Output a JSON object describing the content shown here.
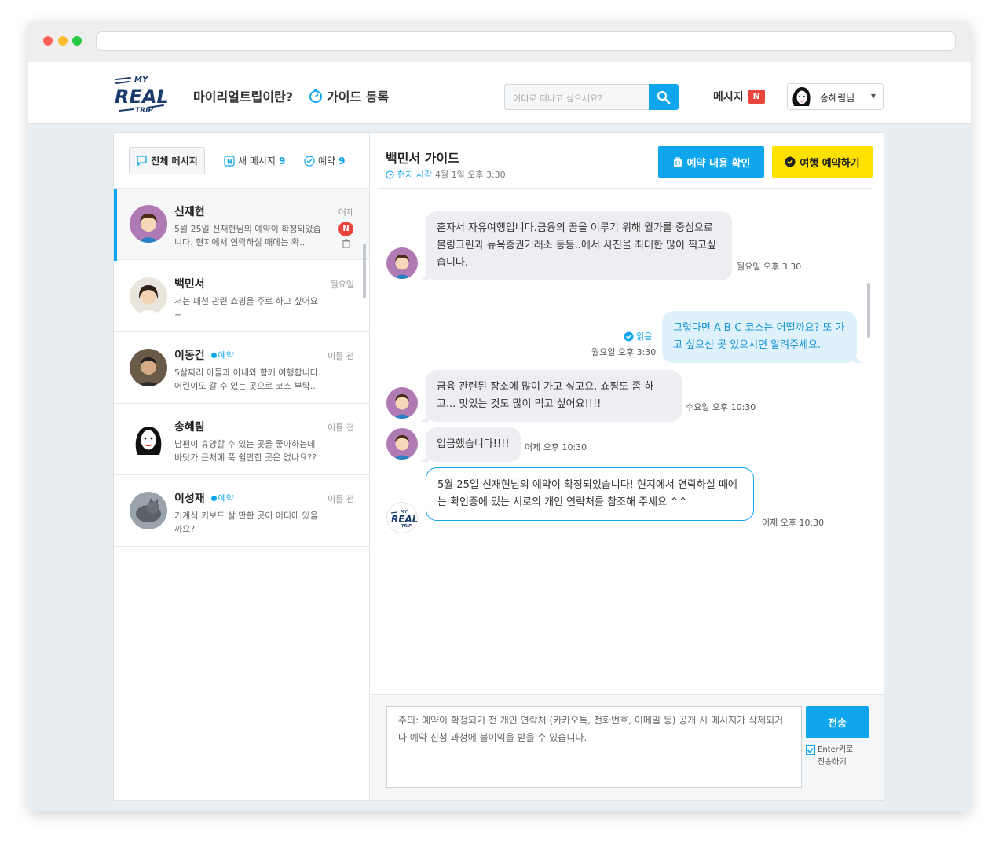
{
  "header": {
    "logo": {
      "line1": "MY",
      "line2": "REAL",
      "line3": "TRIP"
    },
    "nav_about": "마이리얼트립이란?",
    "nav_guide": "가이드 등록",
    "search_placeholder": "어디로 떠나고 싶으세요?",
    "messages_label": "메시지",
    "messages_badge": "N",
    "user_name": "송혜림님"
  },
  "tabs": {
    "all_label": "전체 메시지",
    "new_label": "새 메시지",
    "new_count": "9",
    "resv_label": "예약",
    "resv_count": "9"
  },
  "conversations": [
    {
      "name": "신재현",
      "preview": "5월 25일 신재현님의 예약이 확정되었습니다. 현지에서 연락하실 때에는 확..",
      "time": "어제",
      "badge": "N",
      "tag": ""
    },
    {
      "name": "백민서",
      "preview": "저는 패션 관련 쇼핑을 주로 하고 싶어요~",
      "time": "월요일",
      "tag": ""
    },
    {
      "name": "이동건",
      "preview": "5살짜리 아들과 아내와 함께 여행합니다. 어린이도 갈 수 있는 곳으로 코스 부탁..",
      "time": "이틀 전",
      "tag": "예약"
    },
    {
      "name": "송혜림",
      "preview": "남편이 휴양할 수 있는 곳을 좋아하는데 바닷가 근처에 푹 쉴만한 곳은 없나요??",
      "time": "이틀 전",
      "tag": ""
    },
    {
      "name": "이성재",
      "preview": "기계식 키보드 살 만한 곳이 어디에 있을까요?",
      "time": "이틀 전",
      "tag": "예약"
    }
  ],
  "chat": {
    "guide_name": "백민서 가이드",
    "local_time_label": "현지 시각",
    "local_time": "4월 1일 오후 3:30",
    "btn_check": "예약 내용 확인",
    "btn_book": "여행 예약하기",
    "messages": [
      {
        "text": "혼자서 자유여행입니다.금융의 꿈을 이루기 위해 월가를 중심으로 볼링그린과 뉴욕증권거래소 등등..에서 사진을 최대한 많이 찍고싶습니다.",
        "time": "월요일 오후 3:30"
      },
      {
        "text": "그렇다면 A-B-C 코스는 어떨까요? 또 가고 싶으신 곳 있으시면 알려주세요.",
        "time": "월요일 오후 3:30",
        "read": "읽음"
      },
      {
        "text": "금융 관련된 장소에 많이 가고 싶고요, 쇼핑도 좀 하고... 맛있는 것도 많이 먹고 싶어요!!!!",
        "time": "수요일 오후 10:30"
      },
      {
        "text": "입금했습니다!!!!",
        "time": "어제 오후 10:30"
      },
      {
        "text": "5월 25일 신재현님의 예약이 확정되었습니다! 현지에서 연락하실 때에는 확인증에 있는 서로의 개인 연락처를 참조해 주세요 ^^",
        "time": "어제 오후 10:30"
      }
    ]
  },
  "composer": {
    "placeholder": "주의: 예약이 확정되기 전 개인 연락처 (카카오톡, 전화번호, 이메일 등) 공개 시 메시지가 삭제되거나 예약 신청 과정에 불이익을 받을 수 있습니다.",
    "send_label": "전송",
    "enter_label": "Enter키로 전송하기"
  },
  "colors": {
    "accent": "#0fa6ee",
    "book_button": "#ffe100",
    "badge": "#e8453c"
  }
}
